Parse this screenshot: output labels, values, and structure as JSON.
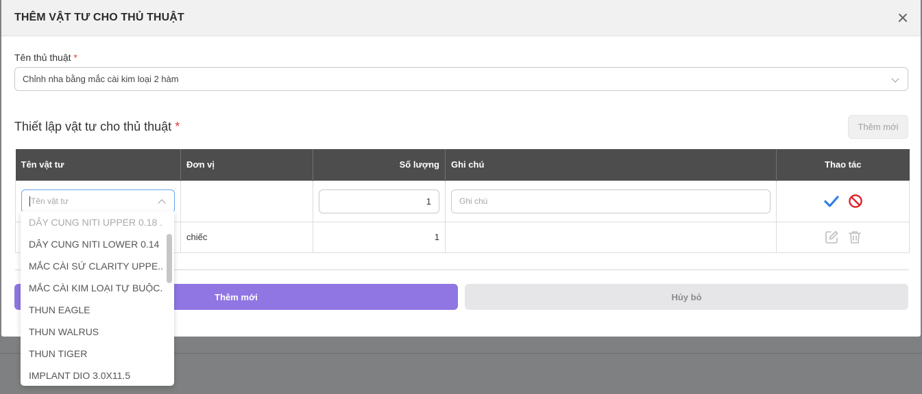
{
  "modal": {
    "title": "THÊM VẬT TƯ CHO THỦ THUẬT",
    "procedure_label": "Tên thủ thuật",
    "required_mark": "*",
    "procedure_value": "Chỉnh nha bằng mắc cài kim loại 2 hàm",
    "section_title": "Thiết lập vật tư cho thủ thuật",
    "add_new_top": "Thêm mới"
  },
  "table": {
    "headers": {
      "name": "Tên vật tư",
      "unit": "Đơn vị",
      "qty": "Số lượng",
      "note": "Ghi chú",
      "actions": "Thao tác"
    },
    "edit_row": {
      "name_placeholder": "Tên vật tư",
      "qty": "1",
      "note_placeholder": "Ghi chú"
    },
    "rows": [
      {
        "unit": "chiếc",
        "qty": "1",
        "note": ""
      }
    ]
  },
  "dropdown": {
    "items": [
      "DÂY CUNG NITI UPPER 0.18 ...",
      "DÂY CUNG NITI LOWER 0.14",
      "MẮC CÀI SỨ CLARITY UPPE...",
      "MẮC CÀI KIM LOẠI TỰ BUỘC...",
      "THUN EAGLE",
      "THUN WALRUS",
      "THUN TIGER",
      "IMPLANT DIO 3.0X11.5"
    ]
  },
  "footer": {
    "submit": "Thêm mới",
    "cancel": "Hủy bỏ"
  },
  "colors": {
    "primary": "#8f76e3",
    "header_bg": "#4d4d4d",
    "confirm": "#2f7fe6",
    "cancel_icon": "#e0202a"
  }
}
